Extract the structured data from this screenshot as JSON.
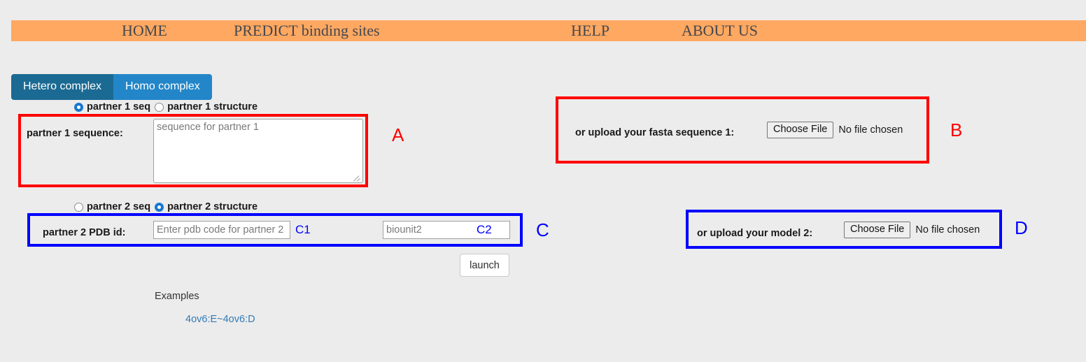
{
  "colors": {
    "navbar_bg": "#ffa861",
    "page_bg": "#ececec",
    "tab_active_bg": "#1b6a93",
    "tab_inactive_bg": "#2386c8",
    "annotation_red": "#ff0000",
    "annotation_blue": "#0000ff",
    "link_blue": "#337ab7"
  },
  "navbar": {
    "items": [
      {
        "label": "HOME"
      },
      {
        "label": "PREDICT binding sites"
      },
      {
        "label": "HELP"
      },
      {
        "label": "ABOUT US"
      }
    ]
  },
  "tabs": [
    {
      "label": "Hetero complex",
      "active": true
    },
    {
      "label": "Homo complex",
      "active": false
    }
  ],
  "partner1": {
    "radios": [
      {
        "label": "partner 1 seq",
        "checked": true
      },
      {
        "label": "partner 1 structure",
        "checked": false
      }
    ],
    "sequence_label": "partner 1 sequence:",
    "sequence_placeholder": "sequence for partner 1",
    "sequence_value": "",
    "marker": "A",
    "upload": {
      "label": "or upload your fasta sequence 1:",
      "button": "Choose File",
      "status": "No file chosen",
      "marker": "B"
    }
  },
  "partner2": {
    "radios": [
      {
        "label": "partner 2 seq",
        "checked": false
      },
      {
        "label": "partner 2 structure",
        "checked": true
      }
    ],
    "pdb_label": "partner 2 PDB id:",
    "pdb_placeholder": "Enter pdb code for partner 2",
    "pdb_value": "",
    "pdb_marker": "C1",
    "biounit_placeholder": "biounit2",
    "biounit_value": "",
    "biounit_marker": "C2",
    "marker": "C",
    "upload": {
      "label": "or upload your model 2:",
      "button": "Choose File",
      "status": "No file chosen",
      "marker": "D"
    }
  },
  "actions": {
    "launch_label": "launch"
  },
  "examples": {
    "heading": "Examples",
    "links": [
      {
        "label": "4ov6:E~4ov6:D"
      }
    ]
  }
}
